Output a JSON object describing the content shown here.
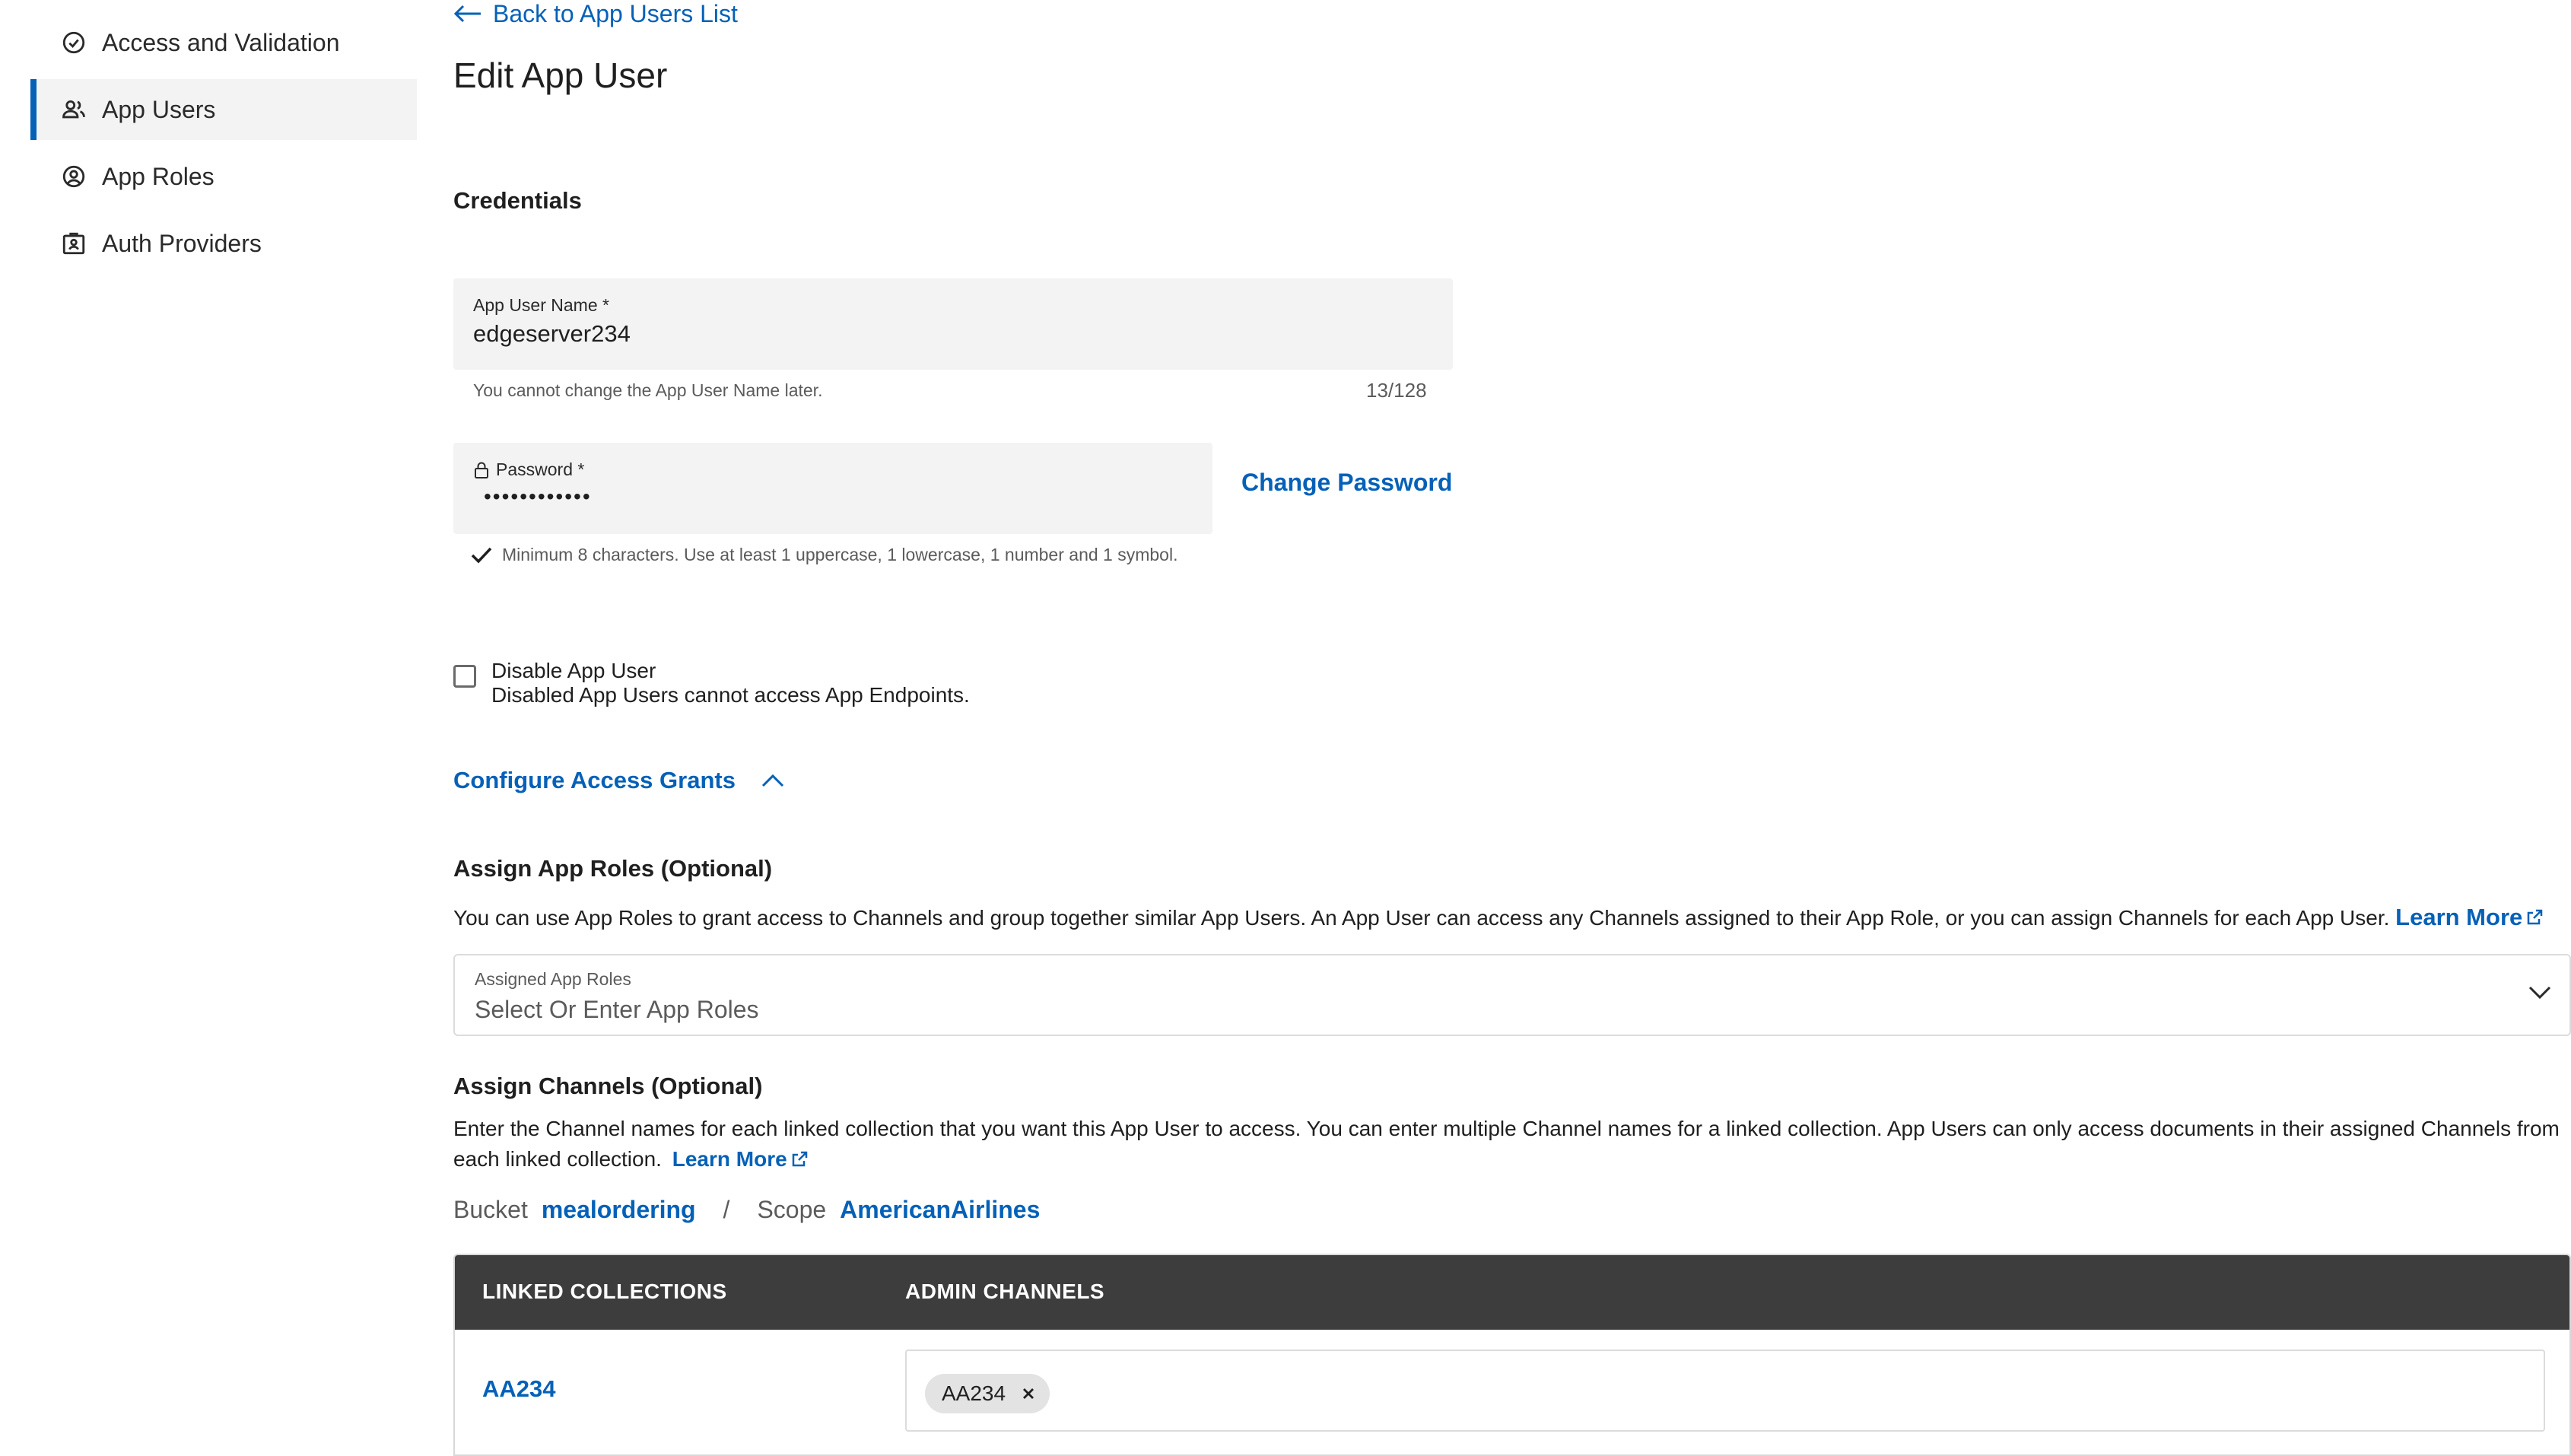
{
  "sidebar": {
    "items": [
      {
        "label": "Access and Validation",
        "icon": "check-circle-icon",
        "active": false
      },
      {
        "label": "App Users",
        "icon": "users-icon",
        "active": true
      },
      {
        "label": "App Roles",
        "icon": "user-circle-icon",
        "active": false
      },
      {
        "label": "Auth Providers",
        "icon": "id-badge-icon",
        "active": false
      }
    ]
  },
  "header": {
    "back_link": "Back to App Users List",
    "title": "Edit App User"
  },
  "credentials": {
    "heading": "Credentials",
    "username": {
      "label": "App User Name *",
      "value": "edgeserver234",
      "helper": "You cannot change the App User Name later.",
      "counter": "13/128"
    },
    "password": {
      "label": "Password *",
      "value": "••••••••••••",
      "change_label": "Change Password",
      "rule": "Minimum 8 characters. Use at least 1 uppercase, 1 lowercase, 1 number and 1 symbol."
    }
  },
  "disable": {
    "title": "Disable App User",
    "subtitle": "Disabled App Users cannot access App Endpoints.",
    "checked": false
  },
  "access_grants": {
    "toggle_label": "Configure Access Grants",
    "expanded": true
  },
  "roles": {
    "heading": "Assign App Roles (Optional)",
    "description": "You can use App Roles to grant access to Channels and group together similar App Users. An App User can access any Channels assigned to their App Role, or you can assign Channels for each App User.",
    "learn_more": "Learn More",
    "select_label": "Assigned App Roles",
    "select_placeholder": "Select Or Enter App Roles"
  },
  "channels": {
    "heading": "Assign Channels (Optional)",
    "description_line1": "Enter the Channel names for each linked collection that you want this App User to access. You can enter multiple Channel names for a linked collection. App Users can only access documents in their assigned Channels from",
    "description_line2": "each linked collection.",
    "learn_more": "Learn More",
    "bucket_label": "Bucket",
    "bucket_value": "mealordering",
    "separator": "/",
    "scope_label": "Scope",
    "scope_value": "AmericanAirlines",
    "table": {
      "headers": [
        "LINKED COLLECTIONS",
        "ADMIN CHANNELS"
      ],
      "rows": [
        {
          "collection": "AA234",
          "chips": [
            "AA234"
          ]
        }
      ]
    }
  },
  "colors": {
    "accent": "#0561b8",
    "table_header": "#3d3d3d",
    "field_bg": "#f3f3f3"
  }
}
